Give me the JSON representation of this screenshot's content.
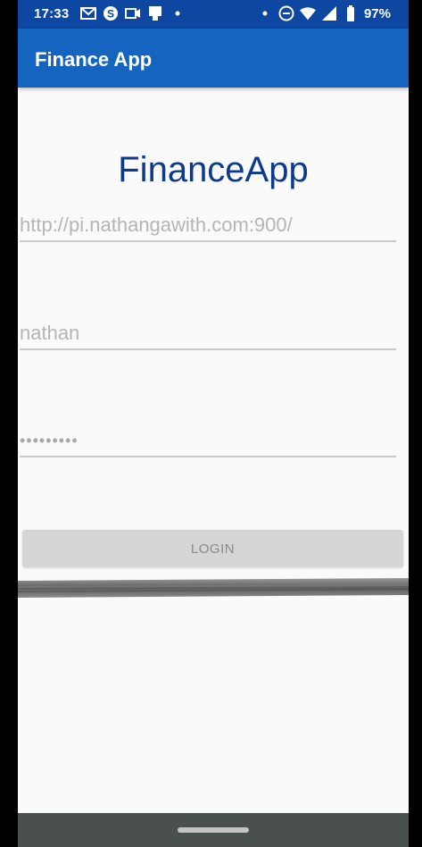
{
  "status_bar": {
    "time": "17:33",
    "battery": "97%",
    "left_icons": [
      "gmail-icon",
      "s-app-icon",
      "video-icon",
      "cast-icon",
      "dot-icon"
    ],
    "right_icons": [
      "dot-icon",
      "do-not-disturb-icon",
      "wifi-icon",
      "signal-icon",
      "battery-icon"
    ]
  },
  "app_bar": {
    "title": "Finance App"
  },
  "main": {
    "brand_title": "FinanceApp",
    "server_url": "http://pi.nathangawith.com:900/",
    "username": "nathan",
    "password_masked": "•••••••••",
    "login_label": "LOGIN"
  },
  "colors": {
    "status_bar": "#0d47a1",
    "app_bar": "#1565c0",
    "brand_title": "#0d3a8c",
    "button": "#d6d6d6"
  }
}
